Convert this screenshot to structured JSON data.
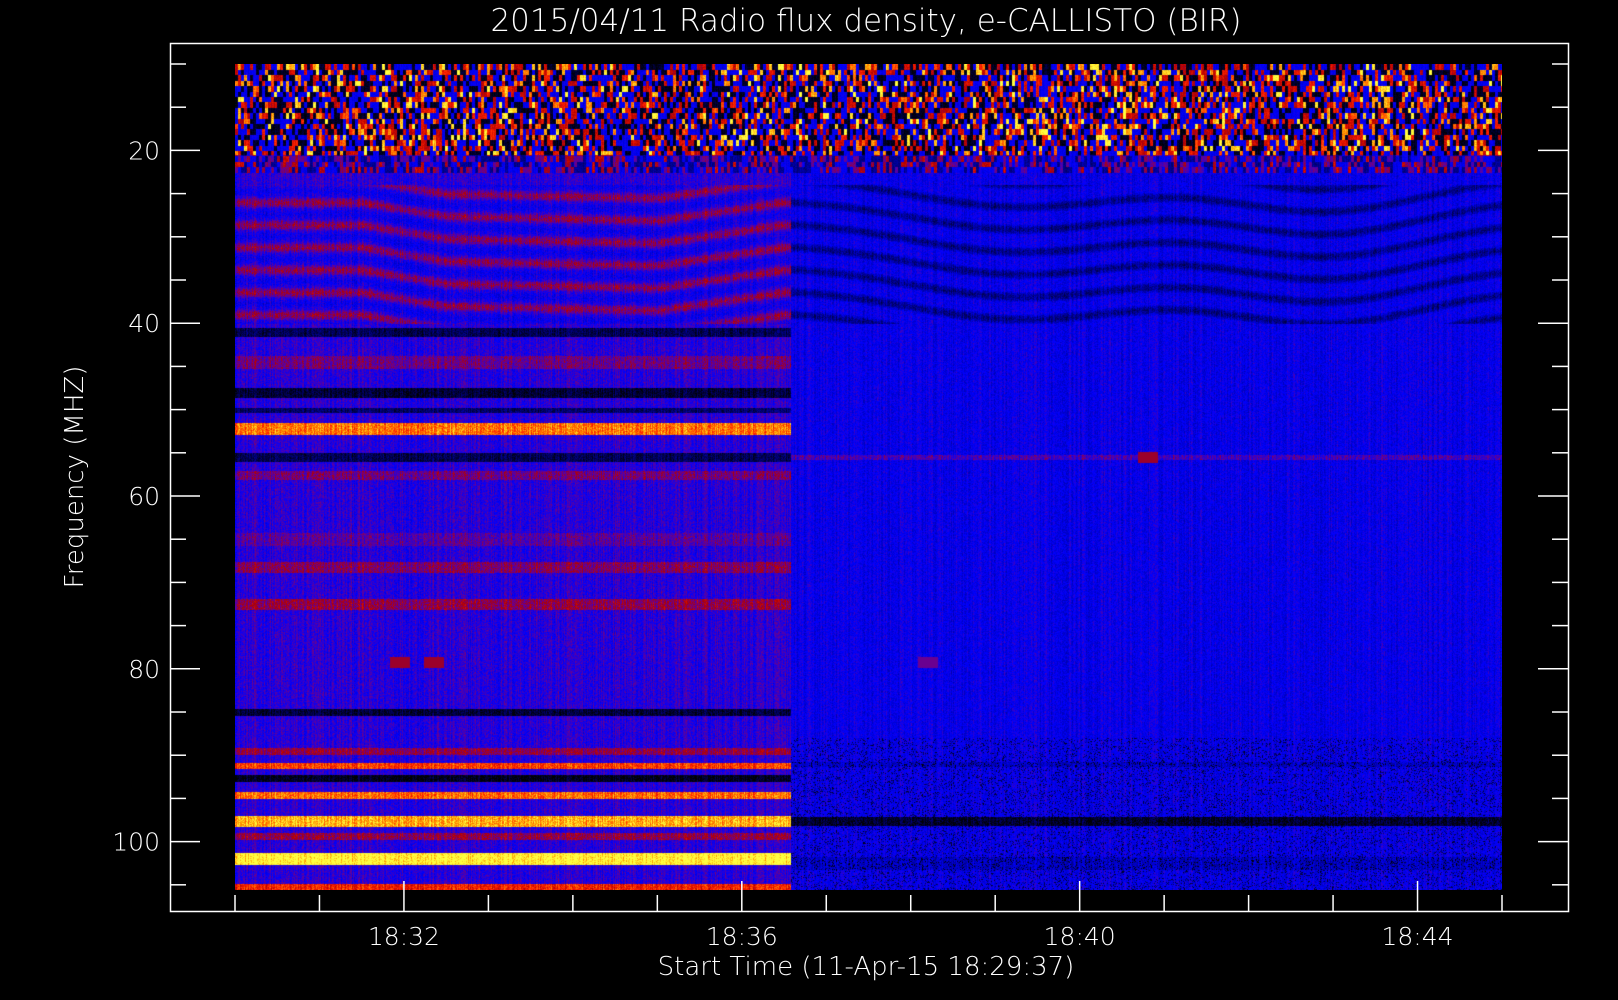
{
  "chart_data": {
    "type": "heatmap",
    "title": "2015/04/11  Radio flux density, e-CALLISTO (BIR)",
    "xlabel": "Start Time (11-Apr-15 18:29:37)",
    "ylabel": "Frequency (MHZ)",
    "x_unit": "minutes after 18:00",
    "xlim": [
      30,
      45
    ],
    "ylim": [
      105.6,
      10
    ],
    "y_inverted": true,
    "x_major_ticks": [
      {
        "v": 32,
        "label": "18:32"
      },
      {
        "v": 36,
        "label": "18:36"
      },
      {
        "v": 40,
        "label": "18:40"
      },
      {
        "v": 44,
        "label": "18:44"
      }
    ],
    "x_minor_step": 1,
    "y_major_ticks": [
      {
        "v": 20,
        "label": "20"
      },
      {
        "v": 40,
        "label": "40"
      },
      {
        "v": 60,
        "label": "60"
      },
      {
        "v": 80,
        "label": "80"
      },
      {
        "v": 100,
        "label": "100"
      }
    ],
    "y_minor_step": 5,
    "colormap": [
      "#000000",
      "#0000c8",
      "#0000ff",
      "#6a0090",
      "#b00000",
      "#ff2000",
      "#ff9a00",
      "#ffff40"
    ],
    "regime_change_time": 36.58,
    "rfi_band_mhz": [
      10,
      22.5
    ],
    "left_background": 0.45,
    "right_background": 0.38,
    "left_bands": [
      {
        "f": 41,
        "w": 1.0,
        "v": 0.12
      },
      {
        "f": 44.5,
        "w": 1.5,
        "v": 0.55
      },
      {
        "f": 48,
        "w": 1.2,
        "v": 0.08
      },
      {
        "f": 50,
        "w": 0.6,
        "v": 0.15
      },
      {
        "f": 52.2,
        "w": 1.3,
        "v": 0.86
      },
      {
        "f": 55.5,
        "w": 1.0,
        "v": 0.12
      },
      {
        "f": 57.6,
        "w": 1.0,
        "v": 0.56
      },
      {
        "f": 65,
        "w": 1.5,
        "v": 0.52
      },
      {
        "f": 68.2,
        "w": 1.2,
        "v": 0.58
      },
      {
        "f": 72.5,
        "w": 1.2,
        "v": 0.6
      },
      {
        "f": 85,
        "w": 0.9,
        "v": 0.08
      },
      {
        "f": 89.5,
        "w": 0.8,
        "v": 0.6
      },
      {
        "f": 91.2,
        "w": 0.7,
        "v": 0.8
      },
      {
        "f": 92.6,
        "w": 0.8,
        "v": 0.04
      },
      {
        "f": 94.6,
        "w": 0.8,
        "v": 0.85
      },
      {
        "f": 97.6,
        "w": 1.2,
        "v": 0.92
      },
      {
        "f": 99.3,
        "w": 0.8,
        "v": 0.6
      },
      {
        "f": 102,
        "w": 1.4,
        "v": 1.0
      },
      {
        "f": 105.2,
        "w": 0.7,
        "v": 0.76
      }
    ],
    "right_bands": [
      {
        "f": 97.6,
        "w": 1.0,
        "v": 0.08
      },
      {
        "f": 91,
        "w": 0.6,
        "v": 0.3
      },
      {
        "f": 55.5,
        "w": 0.6,
        "v": 0.5
      },
      {
        "f": 102.5,
        "w": 1.5,
        "v": 0.3
      }
    ],
    "spots": [
      {
        "t": 31.95,
        "f": 79.2,
        "v": 0.62
      },
      {
        "t": 32.35,
        "f": 79.2,
        "v": 0.62
      },
      {
        "t": 38.2,
        "f": 79.2,
        "v": 0.55
      },
      {
        "t": 40.8,
        "f": 55.5,
        "v": 0.62
      }
    ]
  }
}
